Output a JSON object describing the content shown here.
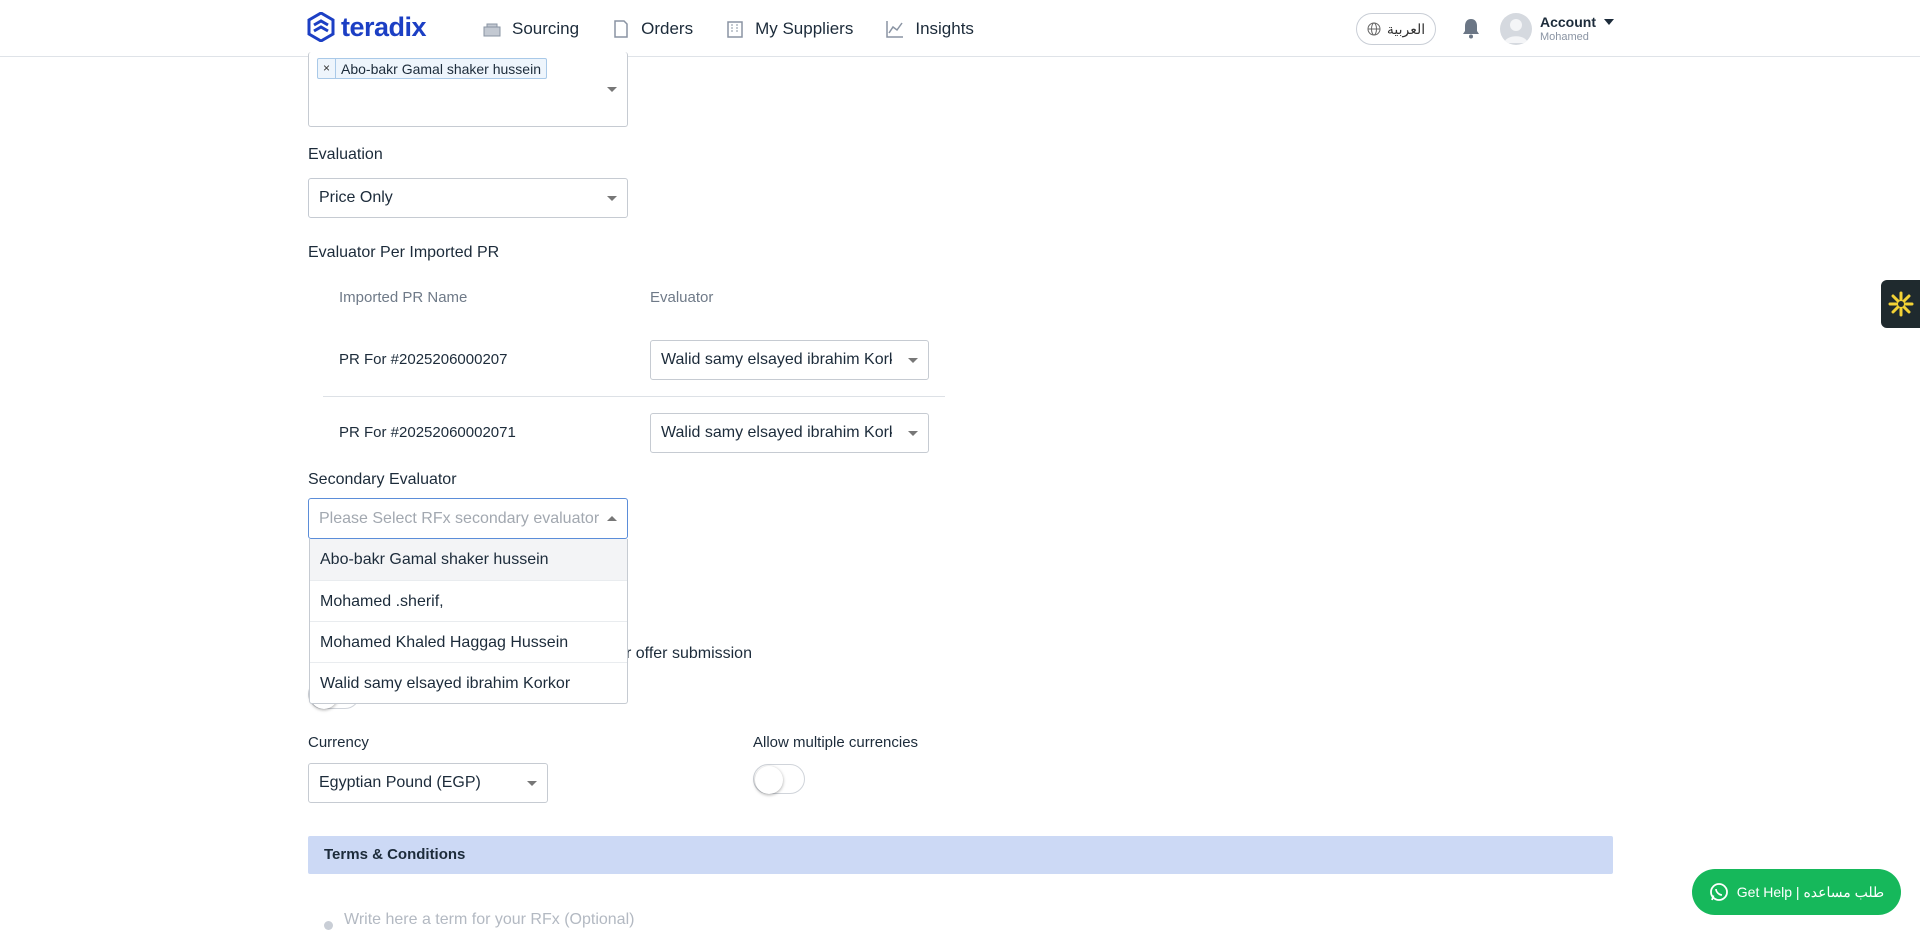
{
  "nav": {
    "logo": "teradix",
    "items": [
      {
        "label": "Sourcing",
        "icon": "sourcing-icon"
      },
      {
        "label": "Orders",
        "icon": "orders-icon"
      },
      {
        "label": "My Suppliers",
        "icon": "suppliers-icon"
      },
      {
        "label": "Insights",
        "icon": "insights-icon"
      }
    ],
    "language": "العربية",
    "account_label": "Account",
    "account_user": "Mohamed"
  },
  "form": {
    "evaluators_tag": "Abo-bakr Gamal shaker hussein",
    "evaluation_label": "Evaluation",
    "evaluation_value": "Price Only",
    "per_pr_label": "Evaluator Per Imported PR",
    "pr_table": {
      "col_name": "Imported PR Name",
      "col_evaluator": "Evaluator",
      "rows": [
        {
          "name": "PR For #2025206000207",
          "evaluator": "Walid samy elsayed ibrahim Korkor"
        },
        {
          "name": "PR For #20252060002071",
          "evaluator": "Walid samy elsayed ibrahim Korkor"
        }
      ]
    },
    "secondary_label": "Secondary Evaluator",
    "secondary_placeholder": "Please Select RFx secondary evaluator",
    "secondary_options": [
      "Abo-bakr Gamal shaker hussein",
      "Mohamed .sherif,",
      "Mohamed Khaled Haggag Hussein",
      "Walid samy elsayed ibrahim Korkor"
    ],
    "hidden_label_tail": "r offer submission",
    "currency_label": "Currency",
    "currency_value": "Egyptian Pound (EGP)",
    "multi_currency_label": "Allow multiple currencies",
    "terms_title": "Terms & Conditions",
    "terms_placeholder": "Write here a term for your RFx (Optional)"
  },
  "help": {
    "label": "Get Help | طلب مساعده"
  },
  "colors": {
    "brand": "#1c3fc4",
    "help": "#16b85b",
    "section": "#ccd9f5"
  }
}
